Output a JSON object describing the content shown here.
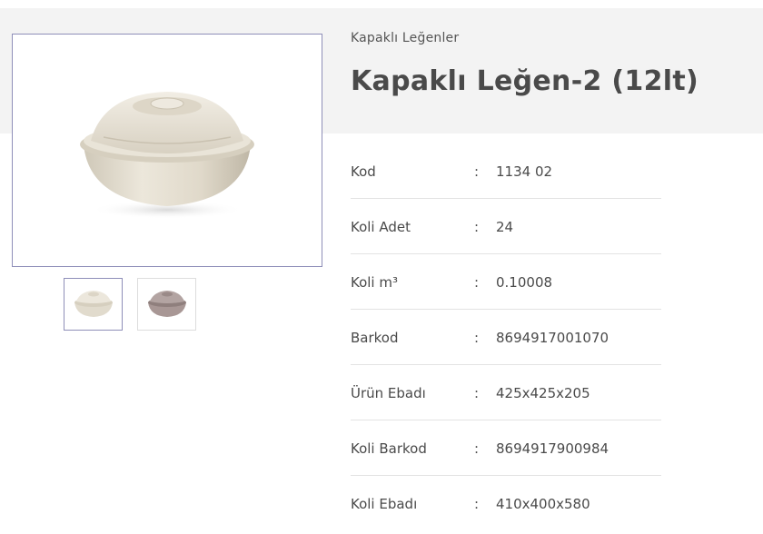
{
  "breadcrumb": "Kapaklı Leğenler",
  "product": {
    "title": "Kapaklı Leğen-2 (12lt)"
  },
  "specs": [
    {
      "label": "Kod",
      "value": "1134 02"
    },
    {
      "label": "Koli Adet",
      "value": "24"
    },
    {
      "label": "Koli m³",
      "value": "0.10008"
    },
    {
      "label": "Barkod",
      "value": "8694917001070"
    },
    {
      "label": "Ürün Ebadı",
      "value": "425x425x205"
    },
    {
      "label": "Koli Barkod",
      "value": "8694917900984"
    },
    {
      "label": "Koli Ebadı",
      "value": "410x400x580"
    }
  ],
  "separator": ":",
  "colors": {
    "header_bg": "#f3f3f3",
    "text": "#4a4a4a",
    "active_border": "#8e8eb8",
    "bowl_cream": "#e3ddd0",
    "bowl_mauve": "#9e8e8c"
  },
  "images": {
    "main": "cream-bowl-with-lid",
    "thumbnails": [
      "cream-bowl-with-lid",
      "mauve-bowl-with-lid"
    ]
  }
}
